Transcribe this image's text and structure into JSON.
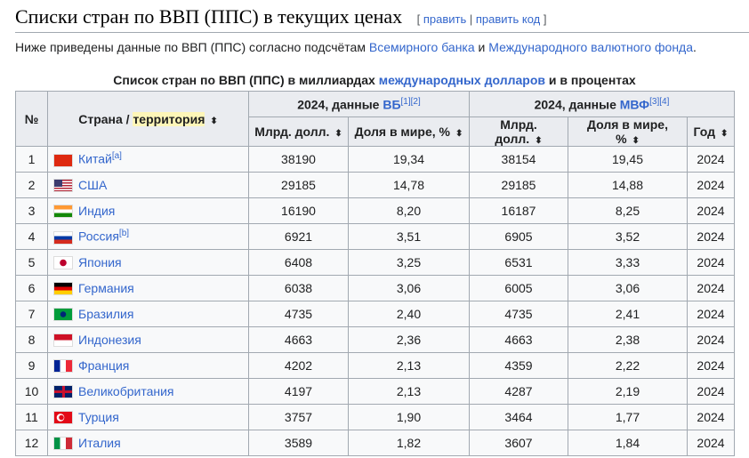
{
  "heading": {
    "title": "Списки стран по ВВП (ППС) в текущих ценах",
    "edit": "править",
    "edit_code": "править код"
  },
  "intro": {
    "text1": "Ниже приведены данные по ВВП (ППС) согласно подсчётам ",
    "link1": "Всемирного банка",
    "text2": " и ",
    "link2": "Международного валютного фонда",
    "text3": "."
  },
  "caption": {
    "text1": "Список стран по ВВП (ППС) в миллиардах ",
    "link": "международных долларов",
    "text2": " и в процентах"
  },
  "headers": {
    "num": "№",
    "country": "Страна / ",
    "territory": "территория",
    "wb": "2024, данные ",
    "wb_link": "ВБ",
    "wb_refs": "[1][2]",
    "imf": "2024, данные ",
    "imf_link": "МВФ",
    "imf_refs": "[3][4]",
    "bn": "Млрд. долл.",
    "share": "Доля в мире, %",
    "year": "Год",
    "sort_icon": "⬍"
  },
  "rows": [
    {
      "n": "1",
      "country": "Китай",
      "note": "[a]",
      "flag": "china",
      "wb_bn": "38190",
      "wb_share": "19,34",
      "imf_bn": "38154",
      "imf_share": "19,45",
      "year": "2024"
    },
    {
      "n": "2",
      "country": "США",
      "note": "",
      "flag": "usa",
      "wb_bn": "29185",
      "wb_share": "14,78",
      "imf_bn": "29185",
      "imf_share": "14,88",
      "year": "2024"
    },
    {
      "n": "3",
      "country": "Индия",
      "note": "",
      "flag": "india",
      "wb_bn": "16190",
      "wb_share": "8,20",
      "imf_bn": "16187",
      "imf_share": "8,25",
      "year": "2024"
    },
    {
      "n": "4",
      "country": "Россия",
      "note": "[b]",
      "flag": "russia",
      "wb_bn": "6921",
      "wb_share": "3,51",
      "imf_bn": "6905",
      "imf_share": "3,52",
      "year": "2024"
    },
    {
      "n": "5",
      "country": "Япония",
      "note": "",
      "flag": "japan",
      "wb_bn": "6408",
      "wb_share": "3,25",
      "imf_bn": "6531",
      "imf_share": "3,33",
      "year": "2024"
    },
    {
      "n": "6",
      "country": "Германия",
      "note": "",
      "flag": "germany",
      "wb_bn": "6038",
      "wb_share": "3,06",
      "imf_bn": "6005",
      "imf_share": "3,06",
      "year": "2024"
    },
    {
      "n": "7",
      "country": "Бразилия",
      "note": "",
      "flag": "brazil",
      "wb_bn": "4735",
      "wb_share": "2,40",
      "imf_bn": "4735",
      "imf_share": "2,41",
      "year": "2024"
    },
    {
      "n": "8",
      "country": "Индонезия",
      "note": "",
      "flag": "indonesia",
      "wb_bn": "4663",
      "wb_share": "2,36",
      "imf_bn": "4663",
      "imf_share": "2,38",
      "year": "2024"
    },
    {
      "n": "9",
      "country": "Франция",
      "note": "",
      "flag": "france",
      "wb_bn": "4202",
      "wb_share": "2,13",
      "imf_bn": "4359",
      "imf_share": "2,22",
      "year": "2024"
    },
    {
      "n": "10",
      "country": "Великобритания",
      "note": "",
      "flag": "uk",
      "wb_bn": "4197",
      "wb_share": "2,13",
      "imf_bn": "4287",
      "imf_share": "2,19",
      "year": "2024"
    },
    {
      "n": "11",
      "country": "Турция",
      "note": "",
      "flag": "turkey",
      "wb_bn": "3757",
      "wb_share": "1,90",
      "imf_bn": "3464",
      "imf_share": "1,77",
      "year": "2024"
    },
    {
      "n": "12",
      "country": "Италия",
      "note": "",
      "flag": "italy",
      "wb_bn": "3589",
      "wb_share": "1,82",
      "imf_bn": "3607",
      "imf_share": "1,84",
      "year": "2024"
    }
  ]
}
